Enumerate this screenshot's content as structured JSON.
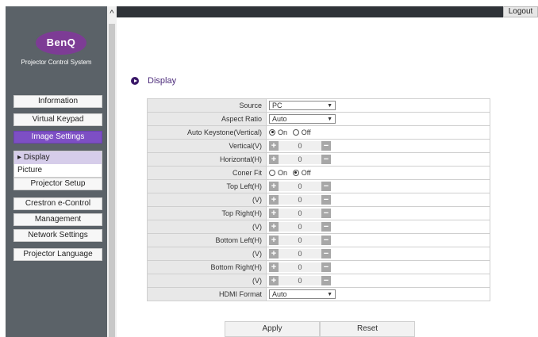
{
  "header": {
    "logout_label": "Logout"
  },
  "brand": {
    "logo_text": "BenQ",
    "system_title": "Projector Control System"
  },
  "sidebar": {
    "items": [
      {
        "label": "Information"
      },
      {
        "label": "Virtual Keypad"
      },
      {
        "label": "Image Settings"
      },
      {
        "label": "Projector Setup"
      },
      {
        "label": "Crestron e-Control"
      },
      {
        "label": "Management"
      },
      {
        "label": "Network Settings"
      },
      {
        "label": "Projector Language"
      }
    ],
    "submenu": [
      {
        "label": "Display"
      },
      {
        "label": "Picture"
      }
    ]
  },
  "page": {
    "title": "Display"
  },
  "radio_labels": {
    "on": "On",
    "off": "Off"
  },
  "settings": {
    "source": {
      "label": "Source",
      "value": "PC"
    },
    "aspect_ratio": {
      "label": "Aspect Ratio",
      "value": "Auto"
    },
    "auto_keystone": {
      "label": "Auto Keystone(Vertical)",
      "value": "On"
    },
    "vertical": {
      "label": "Vertical(V)",
      "value": "0"
    },
    "horizontal": {
      "label": "Horizontal(H)",
      "value": "0"
    },
    "corner_fit": {
      "label": "Coner Fit",
      "value": "Off"
    },
    "top_left_h": {
      "label": "Top Left(H)",
      "value": "0"
    },
    "top_left_v": {
      "label": "(V)",
      "value": "0"
    },
    "top_right_h": {
      "label": "Top Right(H)",
      "value": "0"
    },
    "top_right_v": {
      "label": "(V)",
      "value": "0"
    },
    "bottom_left_h": {
      "label": "Bottom Left(H)",
      "value": "0"
    },
    "bottom_left_v": {
      "label": "(V)",
      "value": "0"
    },
    "bottom_right_h": {
      "label": "Bottom Right(H)",
      "value": "0"
    },
    "bottom_right_v": {
      "label": "(V)",
      "value": "0"
    },
    "hdmi_format": {
      "label": "HDMI Format",
      "value": "Auto"
    }
  },
  "stepper_symbols": {
    "plus": "+",
    "minus": "−"
  },
  "actions": {
    "apply_label": "Apply",
    "reset_label": "Reset"
  },
  "colors": {
    "accent": "#7d4fc4",
    "sidebar_bg": "#5b6268",
    "topbar_bg": "#2f3338",
    "heading": "#4b2a7a"
  }
}
